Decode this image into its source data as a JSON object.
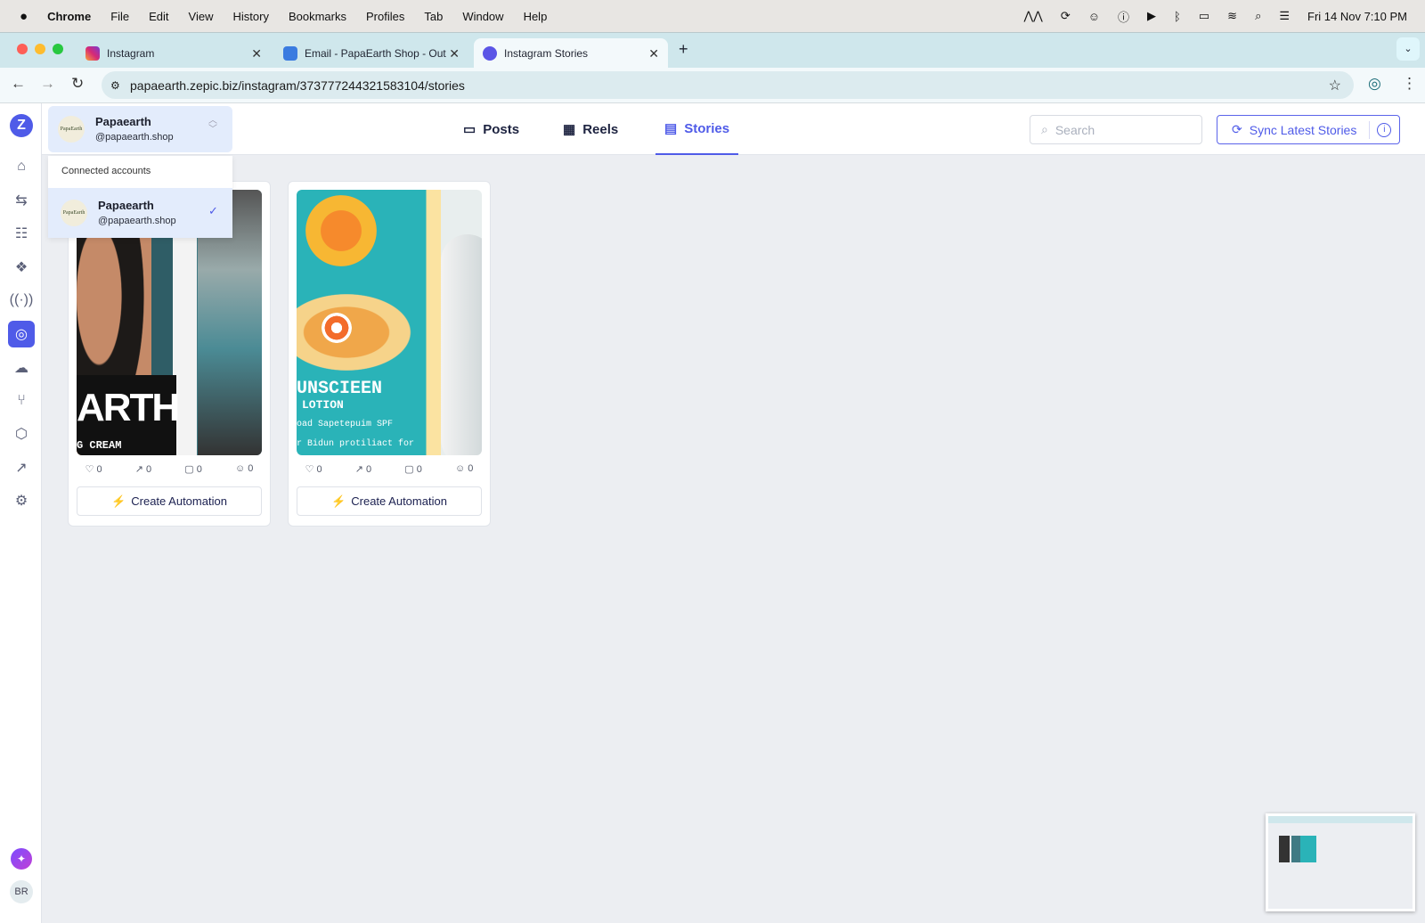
{
  "menubar": {
    "app": "Chrome",
    "items": [
      "File",
      "Edit",
      "View",
      "History",
      "Bookmarks",
      "Profiles",
      "Tab",
      "Window",
      "Help"
    ],
    "clock": "Fri 14 Nov  7:10 PM"
  },
  "browser": {
    "tabs": [
      {
        "title": "Instagram"
      },
      {
        "title": "Email - PapaEarth Shop - Out"
      },
      {
        "title": "Instagram Stories"
      }
    ],
    "url": "papaearth.zepic.biz/instagram/373777244321583104/stories"
  },
  "account": {
    "name": "Papaearth",
    "handle": "@papaearth.shop",
    "logo_text": "PapaEarth"
  },
  "dropdown": {
    "heading": "Connected accounts",
    "items": [
      {
        "name": "Papaearth",
        "handle": "@papaearth.shop",
        "selected": true
      }
    ]
  },
  "page_tabs": [
    {
      "label": "Posts",
      "icon": "monitor-icon"
    },
    {
      "label": "Reels",
      "icon": "film-icon"
    },
    {
      "label": "Stories",
      "icon": "stories-icon",
      "active": true
    }
  ],
  "search": {
    "placeholder": "Search"
  },
  "sync_label": "Sync Latest Stories",
  "cards": [
    {
      "image_text": "ARTH",
      "image_sub": "G CREAM",
      "likes": "0",
      "shares": "0",
      "comments": "0",
      "reactions": "0",
      "button": "Create Automation"
    },
    {
      "image_text": "UNSCIEEN",
      "image_sub": "LOTION",
      "image_line": "oad Sapetepuim SPF",
      "image_line2": "r Bidun protiliact for",
      "likes": "0",
      "shares": "0",
      "comments": "0",
      "reactions": "0",
      "button": "Create Automation"
    }
  ],
  "user_initials": "BR",
  "colors": {
    "accent": "#4f5be8",
    "bolt": "#f4844a"
  }
}
